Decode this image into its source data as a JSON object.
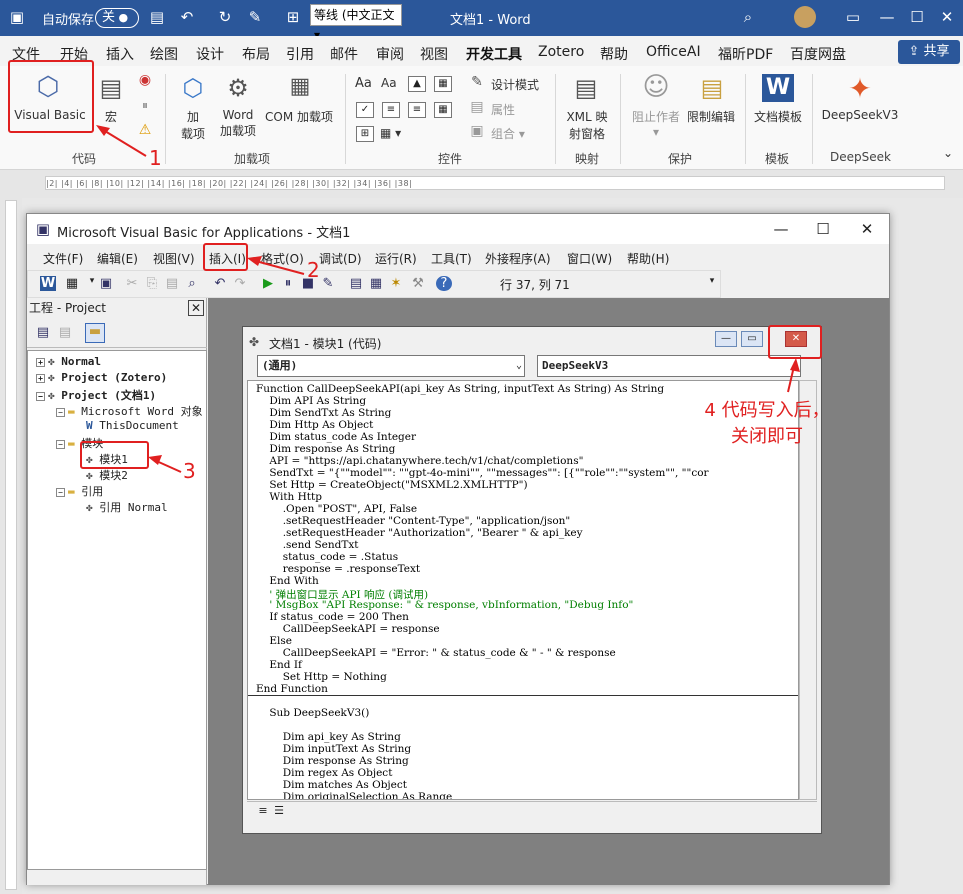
{
  "word": {
    "autosave_label": "自动保存",
    "autosave_state": "关",
    "font_name": "等线 (中文正文",
    "window_title": "文档1 - Word",
    "share_label": "共享",
    "tabs": [
      "文件",
      "开始",
      "插入",
      "绘图",
      "设计",
      "布局",
      "引用",
      "邮件",
      "审阅",
      "视图",
      "开发工具",
      "Zotero",
      "帮助",
      "OfficeAI",
      "福昕PDF",
      "百度网盘"
    ],
    "ribbon": {
      "visual_basic": "Visual Basic",
      "macro": "宏",
      "code_group": "代码",
      "addin_1": "加",
      "addin_1b": "载项",
      "word_addin": "Word",
      "word_addin_b": "加载项",
      "com_addin": "COM 加载项",
      "addins_group": "加载项",
      "design_mode": "设计模式",
      "properties": "属性",
      "group_btn": "组合",
      "controls_group": "控件",
      "xml_mapping": "XML 映",
      "xml_mapping_b": "射窗格",
      "mapping_group": "映射",
      "block_authors": "阻止作者",
      "restrict_editing": "限制编辑",
      "protect_group": "保护",
      "doc_template": "文档模板",
      "template_group": "模板",
      "deepseek_btn": "DeepSeekV3",
      "deepseek_group": "DeepSeek"
    },
    "ruler_text": "|2| |4| |6| |8| |10| |12| |14| |16| |18| |20| |22| |24| |26| |28| |30| |32| |34| |36| |38|"
  },
  "vba": {
    "title": "Microsoft Visual Basic for Applications - 文档1",
    "menus": [
      "文件(F)",
      "编辑(E)",
      "视图(V)",
      "插入(I)",
      "格式(O)",
      "调试(D)",
      "运行(R)",
      "工具(T)",
      "外接程序(A)",
      "窗口(W)",
      "帮助(H)"
    ],
    "position": "行 37, 列 71",
    "project_title": "工程 - Project",
    "tree": {
      "normal": "Normal",
      "zotero": "Project (Zotero)",
      "doc_project": "Project (文档1)",
      "word_objects": "Microsoft Word 对象",
      "this_document": "ThisDocument",
      "modules": "模块",
      "module1": "模块1",
      "module2": "模块2",
      "references": "引用",
      "ref_normal": "引用 Normal"
    },
    "code_window_title": "文档1 - 模块1 (代码)",
    "object_combo": "(通用)",
    "proc_combo": "DeepSeekV3",
    "code_lines": [
      "Function CallDeepSeekAPI(api_key As String, inputText As String) As String",
      "    Dim API As String",
      "    Dim SendTxt As String",
      "    Dim Http As Object",
      "    Dim status_code As Integer",
      "    Dim response As String",
      "    API = \"https://api.chatanywhere.tech/v1/chat/completions\"",
      "    SendTxt = \"{\"\"model\"\": \"\"gpt-4o-mini\"\", \"\"messages\"\": [{\"\"role\"\":\"\"system\"\", \"\"cor",
      "    Set Http = CreateObject(\"MSXML2.XMLHTTP\")",
      "    With Http",
      "        .Open \"POST\", API, False",
      "        .setRequestHeader \"Content-Type\", \"application/json\"",
      "        .setRequestHeader \"Authorization\", \"Bearer \" & api_key",
      "        .send SendTxt",
      "        status_code = .Status",
      "        response = .responseText",
      "    End With",
      "    ' 弹出窗口显示 API 响应 (调试用)",
      "    ' MsgBox \"API Response: \" & response, vbInformation, \"Debug Info\"",
      "    If status_code = 200 Then",
      "        CallDeepSeekAPI = response",
      "    Else",
      "        CallDeepSeekAPI = \"Error: \" & status_code & \" - \" & response",
      "    End If",
      "        Set Http = Nothing",
      "End Function",
      "",
      "    Sub DeepSeekV3()",
      "",
      "        Dim api_key As String",
      "        Dim inputText As String",
      "        Dim response As String",
      "        Dim regex As Object",
      "        Dim matches As Object",
      "        Dim originalSelection As Range"
    ]
  },
  "annotations": {
    "step1": "1",
    "step2": "2",
    "step3": "3",
    "step4_line1": "4 代码写入后，",
    "step4_line2": "关闭即可",
    "color": "#e02020"
  }
}
